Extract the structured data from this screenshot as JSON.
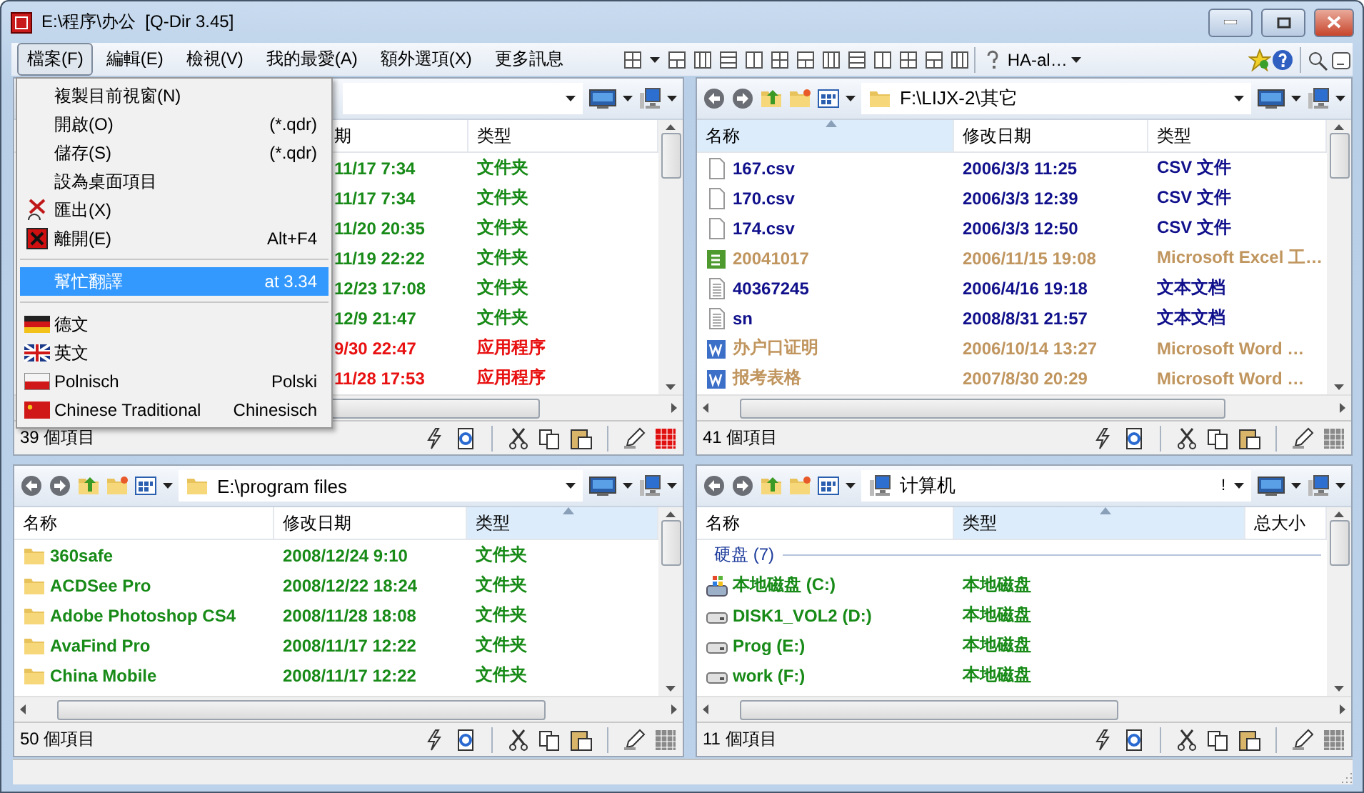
{
  "window": {
    "title": "E:\\程序\\办公  [Q-Dir 3.45]"
  },
  "menu_bar": [
    {
      "label": "檔案(F)",
      "selected": true
    },
    {
      "label": "編輯(E)",
      "selected": false
    },
    {
      "label": "檢視(V)",
      "selected": false
    },
    {
      "label": "我的最愛(A)",
      "selected": false
    },
    {
      "label": "額外選項(X)",
      "selected": false
    },
    {
      "label": "更多訊息",
      "selected": false
    }
  ],
  "toolbar": {
    "profile": "HA-al…"
  },
  "file_menu": [
    {
      "kind": "item",
      "label": "複製目前視窗(N)",
      "selected": false
    },
    {
      "kind": "item",
      "label": "開啟(O)",
      "shortcut": "(*.qdr)",
      "selected": false
    },
    {
      "kind": "item",
      "label": "儲存(S)",
      "shortcut": "(*.qdr)",
      "selected": false
    },
    {
      "kind": "item",
      "label": "設為桌面項目",
      "selected": false
    },
    {
      "kind": "item",
      "label": "匯出(X)",
      "selected": false
    },
    {
      "kind": "item",
      "label": "離開(E)",
      "shortcut": "Alt+F4",
      "selected": false
    },
    {
      "kind": "separator"
    },
    {
      "kind": "item",
      "label": "幫忙翻譯",
      "shortcut": "at 3.34",
      "selected": true
    },
    {
      "kind": "separator"
    },
    {
      "kind": "item",
      "label": "德文",
      "selected": false
    },
    {
      "kind": "item",
      "label": "英文",
      "selected": false
    },
    {
      "kind": "item",
      "label": "Polnisch",
      "shortcut": "Polski",
      "selected": false
    },
    {
      "kind": "item",
      "label": "Chinese Traditional",
      "shortcut": "Chinesisch",
      "selected": false
    }
  ],
  "pane_rows": [
    [
      {
        "active": true,
        "columns": [
          {
            "label": "期",
            "sorted": false
          },
          {
            "label": "类型",
            "sorted": false
          }
        ],
        "rows": [
          {
            "cells": [
              "11/17 7:34",
              "文件夹"
            ],
            "color": "#178a17"
          },
          {
            "cells": [
              "11/17 7:34",
              "文件夹"
            ],
            "color": "#178a17"
          },
          {
            "cells": [
              "11/20 20:35",
              "文件夹"
            ],
            "color": "#178a17"
          },
          {
            "cells": [
              "11/19 22:22",
              "文件夹"
            ],
            "color": "#178a17"
          },
          {
            "cells": [
              "12/23 17:08",
              "文件夹"
            ],
            "color": "#178a17"
          },
          {
            "cells": [
              "12/9 21:47",
              "文件夹"
            ],
            "color": "#178a17"
          },
          {
            "cells": [
              "9/30 22:47",
              "应用程序"
            ],
            "color": "#e81010"
          },
          {
            "cells": [
              "11/28 17:53",
              "应用程序"
            ],
            "color": "#e81010"
          }
        ],
        "status": "39 個項目"
      },
      {
        "active": false,
        "kind": "folder",
        "path": "F:\\LIJX-2\\其它",
        "columns": [
          {
            "label": "名称",
            "sorted": true
          },
          {
            "label": "修改日期",
            "sorted": false
          },
          {
            "label": "类型",
            "sorted": false
          }
        ],
        "rows": [
          {
            "kind": "file",
            "cells": [
              "167.csv",
              "2006/3/3 11:25",
              "CSV 文件"
            ],
            "color": "#10108c"
          },
          {
            "kind": "file",
            "cells": [
              "170.csv",
              "2006/3/3 12:39",
              "CSV 文件"
            ],
            "color": "#10108c"
          },
          {
            "kind": "file",
            "cells": [
              "174.csv",
              "2006/3/3 12:50",
              "CSV 文件"
            ],
            "color": "#10108c"
          },
          {
            "kind": "excel",
            "cells": [
              "20041017",
              "2006/11/15 19:08",
              "Microsoft Excel 工…"
            ],
            "color": "#c0955e"
          },
          {
            "kind": "text",
            "cells": [
              "40367245",
              "2006/4/16 19:18",
              "文本文档"
            ],
            "color": "#10108c"
          },
          {
            "kind": "text",
            "cells": [
              "sn",
              "2008/8/31 21:57",
              "文本文档"
            ],
            "color": "#10108c"
          },
          {
            "kind": "word",
            "cells": [
              "办户口证明",
              "2006/10/14 13:27",
              "Microsoft Word …"
            ],
            "color": "#c0955e"
          },
          {
            "kind": "word",
            "cells": [
              "报考表格",
              "2007/8/30 20:29",
              "Microsoft Word …"
            ],
            "color": "#c0955e"
          }
        ],
        "status": "41 個項目"
      }
    ],
    [
      {
        "active": false,
        "kind": "folder",
        "path": "E:\\program files",
        "columns": [
          {
            "label": "名称",
            "sorted": false
          },
          {
            "label": "修改日期",
            "sorted": false
          },
          {
            "label": "类型",
            "sorted": true
          }
        ],
        "rows": [
          {
            "kind": "folder",
            "cells": [
              "360safe",
              "2008/12/24 9:10",
              "文件夹"
            ],
            "color": "#178a17"
          },
          {
            "kind": "folder",
            "cells": [
              "ACDSee Pro",
              "2008/12/22 18:24",
              "文件夹"
            ],
            "color": "#178a17"
          },
          {
            "kind": "folder",
            "cells": [
              "Adobe Photoshop CS4",
              "2008/11/28 18:08",
              "文件夹"
            ],
            "color": "#178a17"
          },
          {
            "kind": "folder",
            "cells": [
              "AvaFind Pro",
              "2008/11/17 12:22",
              "文件夹"
            ],
            "color": "#178a17"
          },
          {
            "kind": "folder",
            "cells": [
              "China Mobile",
              "2008/11/17 12:22",
              "文件夹"
            ],
            "color": "#178a17"
          }
        ],
        "status": "50 個項目"
      },
      {
        "active": false,
        "kind": "computer",
        "path": "计算机",
        "marker": "!",
        "columns": [
          {
            "label": "名称",
            "sorted": false
          },
          {
            "label": "类型",
            "sorted": true
          },
          {
            "label": "总大小",
            "sorted": false
          }
        ],
        "rows": [
          {
            "kind": "group",
            "cells": [
              "硬盘 (7)"
            ],
            "color": "#1e3c9c"
          },
          {
            "kind": "system-drive",
            "cells": [
              "本地磁盘 (C:)",
              "本地磁盘"
            ],
            "color": "#178a17"
          },
          {
            "kind": "drive",
            "cells": [
              "DISK1_VOL2 (D:)",
              "本地磁盘"
            ],
            "color": "#178a17"
          },
          {
            "kind": "drive",
            "cells": [
              "Prog (E:)",
              "本地磁盘"
            ],
            "color": "#178a17"
          },
          {
            "kind": "drive",
            "cells": [
              "work (F:)",
              "本地磁盘"
            ],
            "color": "#178a17"
          }
        ],
        "status": "11 個項目"
      }
    ]
  ]
}
